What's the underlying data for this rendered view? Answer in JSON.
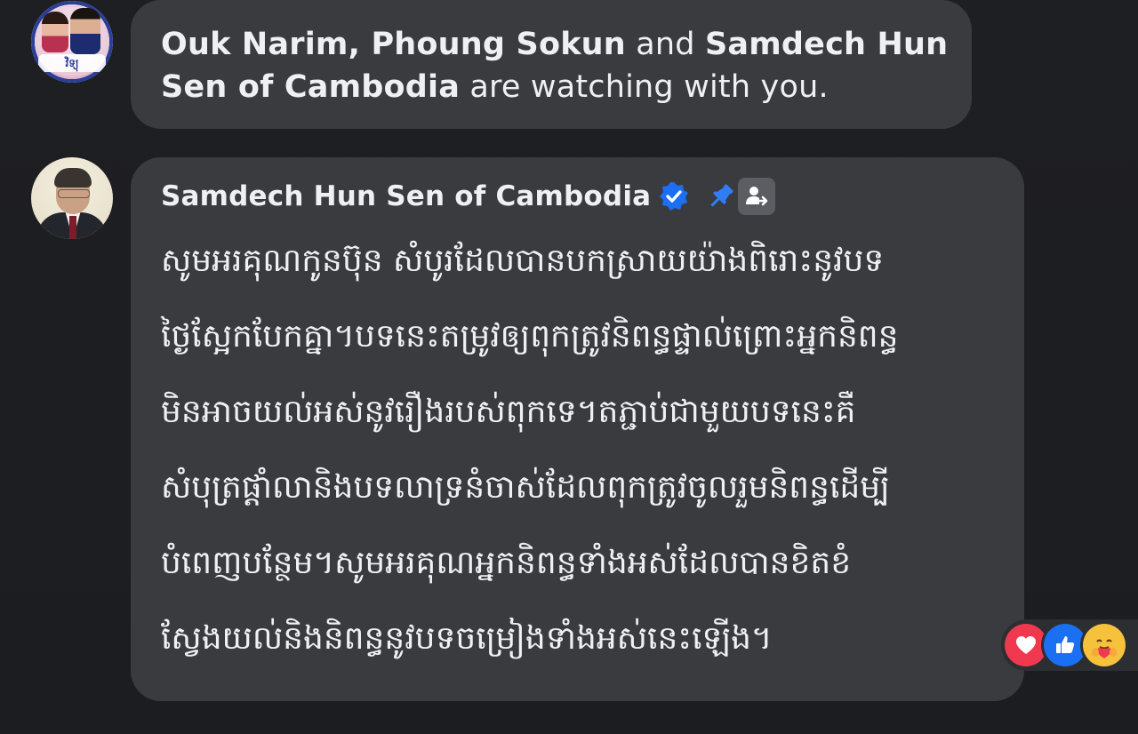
{
  "watching_notice": {
    "names_part1": "Ouk Narim, Phoung Sokun",
    "connector": " and ",
    "names_part2": "Samdech Hun Sen of Cambodia",
    "suffix": " are watching with you."
  },
  "group_avatar": {
    "logo_text": "វិទ្យុ"
  },
  "comment": {
    "author": "Samdech Hun Sen of Cambodia",
    "body_lines": [
      "សូមអរគុណកូនប៊ុន សំបូរដែលបានបកស្រាយយ៉ាងពិរោះនូវបទ",
      "ថ្ងៃស្អែកបែកគ្នា។បទនេះតម្រូវឲ្យពុកត្រូវនិពន្ធផ្ទាល់ព្រោះអ្នកនិពន្ធ",
      "មិនអាចយល់អស់នូវរឿងរបស់ពុកទេ។តភ្ជាប់ជាមួយបទនេះគឺ",
      "សំបុត្រផ្ដាំលានិងបទលាទ្រនំចាស់ដែលពុកត្រូវចូលរួមនិពន្ធដើម្បី",
      "បំពេញបន្ថែម។សូមអរគុណអ្នកនិពន្ធទាំងអស់ដែលបានខិតខំ",
      "ស្វែងយល់និងនិពន្ធនូវបទចម្រៀងទាំងអស់នេះឡើង។"
    ]
  },
  "icons": {
    "verified": "verified-badge-icon",
    "pin": "pin-icon",
    "admin": "admin-badge-icon",
    "reactions": [
      "love-reaction-icon",
      "like-reaction-icon",
      "care-reaction-icon"
    ]
  },
  "colors": {
    "background": "#1c1d21",
    "bubble": "#3a3b3f",
    "verified": "#1a6ff2",
    "love": "#f0384f",
    "like": "#1a6ff2",
    "care": "#f6c23c"
  }
}
